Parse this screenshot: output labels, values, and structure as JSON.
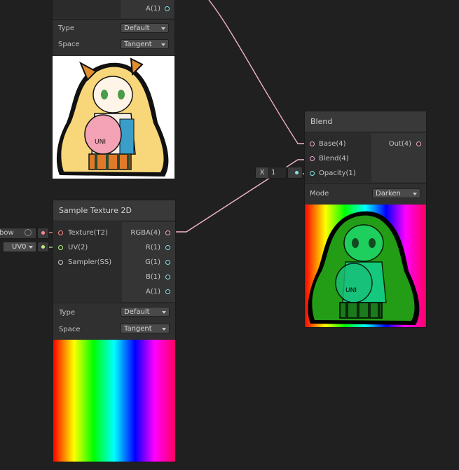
{
  "colors": {
    "canvas": "#202020",
    "wire": "#f2b2cf",
    "port_vec4": "#f1a8d4",
    "port_vec1": "#84e4e7",
    "port_vec2": "#b8f08a",
    "port_texture": "#ff8b8b",
    "port_sampler": "#cccccc"
  },
  "top_node": {
    "ports_out": [
      {
        "label": "A(1)",
        "color": "#84e4e7",
        "icon": "port-vec1"
      }
    ],
    "props": {
      "type_label": "Type",
      "type_value": "Default",
      "space_label": "Space",
      "space_value": "Tangent"
    },
    "preview_icon": "anime-girl-with-pink-plush-preview"
  },
  "sample_node": {
    "title": "Sample Texture 2D",
    "ports_in": [
      {
        "label": "Texture(T2)",
        "color": "#ff8b8b"
      },
      {
        "label": "UV(2)",
        "color": "#b8f08a"
      },
      {
        "label": "Sampler(SS)",
        "color": "#cccccc"
      }
    ],
    "ports_out": [
      {
        "label": "RGBA(4)",
        "color": "#f1a8d4"
      },
      {
        "label": "R(1)",
        "color": "#84e4e7"
      },
      {
        "label": "G(1)",
        "color": "#84e4e7"
      },
      {
        "label": "B(1)",
        "color": "#84e4e7"
      },
      {
        "label": "A(1)",
        "color": "#84e4e7"
      }
    ],
    "props": {
      "type_label": "Type",
      "type_value": "Default",
      "space_label": "Space",
      "space_value": "Tangent"
    },
    "preview_icon": "rainbow-gradient-preview"
  },
  "left_inputs": {
    "texture_field": "bow",
    "uv_value": "UV0"
  },
  "blend_node": {
    "title": "Blend",
    "ports_in": [
      {
        "label": "Base(4)",
        "color": "#f1a8d4"
      },
      {
        "label": "Blend(4)",
        "color": "#f1a8d4"
      },
      {
        "label": "Opacity(1)",
        "color": "#84e4e7"
      }
    ],
    "ports_out": [
      {
        "label": "Out(4)",
        "color": "#f1a8d4"
      }
    ],
    "opacity_field": {
      "axis": "X",
      "value": "1"
    },
    "props": {
      "mode_label": "Mode",
      "mode_value": "Darken"
    },
    "preview_icon": "darkened-rainbow-anime-girl-preview"
  }
}
